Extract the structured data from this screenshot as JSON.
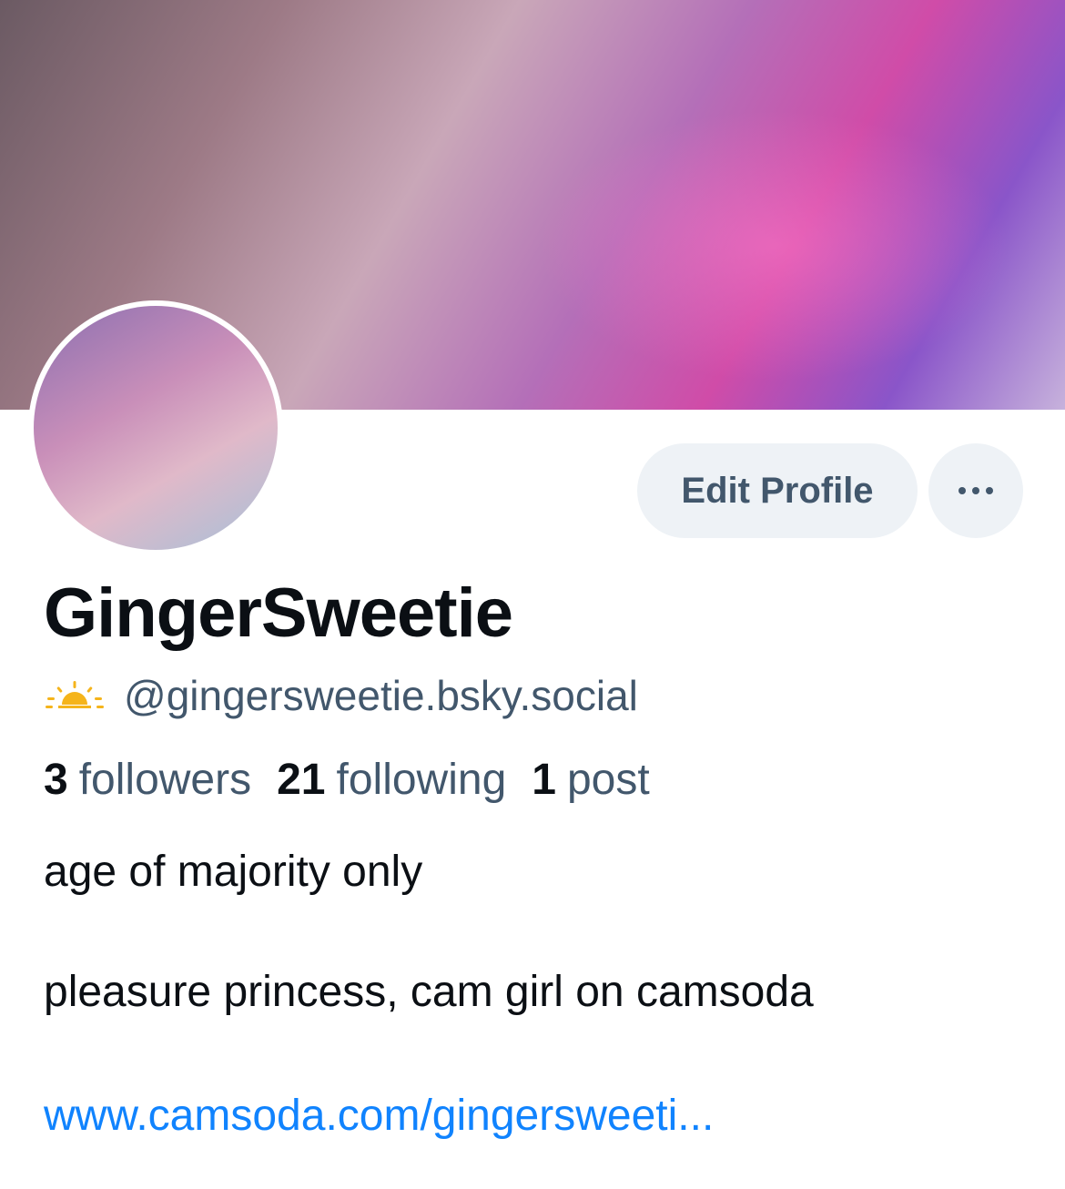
{
  "profile": {
    "display_name": "GingerSweetie",
    "handle": "@gingersweetie.bsky.social",
    "handle_icon": "sunrise-icon"
  },
  "actions": {
    "edit_label": "Edit Profile"
  },
  "stats": {
    "followers_count": "3",
    "followers_label": "followers",
    "following_count": "21",
    "following_label": "following",
    "posts_count": "1",
    "posts_label": "post"
  },
  "bio": {
    "line1": "age of majority only",
    "line2": "pleasure princess, cam girl on camsoda",
    "link": "www.camsoda.com/gingersweeti..."
  },
  "colors": {
    "text_primary": "#0b0f14",
    "text_secondary": "#42576c",
    "link": "#1083fe",
    "button_bg": "#eef2f6"
  }
}
